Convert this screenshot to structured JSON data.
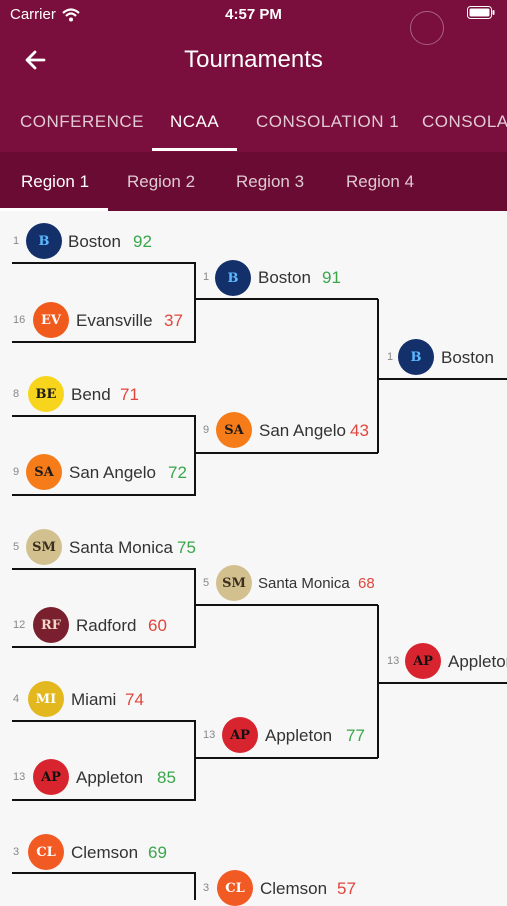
{
  "status": {
    "carrier": "Carrier",
    "time": "4:57 PM"
  },
  "header": {
    "title": "Tournaments"
  },
  "tabs": [
    "CONFERENCE",
    "NCAA",
    "CONSOLATION 1",
    "CONSOLAT"
  ],
  "regions": [
    "Region 1",
    "Region 2",
    "Region 3",
    "Region 4"
  ],
  "round1": [
    {
      "seed": "1",
      "logo": "B",
      "name": "Boston",
      "score": "92",
      "result": "win",
      "bg": "#14306b",
      "fg": "#5bb8ff"
    },
    {
      "seed": "16",
      "logo": "EV",
      "name": "Evansville",
      "score": "37",
      "result": "lose",
      "bg": "#f05a1c",
      "fg": "#ffffff"
    },
    {
      "seed": "8",
      "logo": "BE",
      "name": "Bend",
      "score": "71",
      "result": "lose",
      "bg": "#f7d51d",
      "fg": "#1a1a1a"
    },
    {
      "seed": "9",
      "logo": "SA",
      "name": "San Angelo",
      "score": "72",
      "result": "win",
      "bg": "#f57c18",
      "fg": "#1a1a1a"
    },
    {
      "seed": "5",
      "logo": "SM",
      "name": "Santa Monica",
      "score": "75",
      "result": "win",
      "bg": "#d2c08f",
      "fg": "#3a2f1c"
    },
    {
      "seed": "12",
      "logo": "RF",
      "name": "Radford",
      "score": "60",
      "result": "lose",
      "bg": "#7a1f2e",
      "fg": "#f2d7c8"
    },
    {
      "seed": "4",
      "logo": "MI",
      "name": "Miami",
      "score": "74",
      "result": "lose",
      "bg": "#e3b81f",
      "fg": "#ffffff"
    },
    {
      "seed": "13",
      "logo": "AP",
      "name": "Appleton",
      "score": "85",
      "result": "win",
      "bg": "#d8242e",
      "fg": "#111111"
    },
    {
      "seed": "3",
      "logo": "CL",
      "name": "Clemson",
      "score": "69",
      "result": "win",
      "bg": "#f25a24",
      "fg": "#ffffff"
    }
  ],
  "round2": [
    {
      "seed": "1",
      "logo": "B",
      "name": "Boston",
      "score": "91",
      "result": "win",
      "bg": "#14306b",
      "fg": "#5bb8ff"
    },
    {
      "seed": "9",
      "logo": "SA",
      "name": "San Angelo",
      "score": "43",
      "result": "lose",
      "bg": "#f57c18",
      "fg": "#1a1a1a"
    },
    {
      "seed": "5",
      "logo": "SM",
      "name": "Santa Monica",
      "score": "68",
      "result": "lose",
      "bg": "#d2c08f",
      "fg": "#3a2f1c"
    },
    {
      "seed": "13",
      "logo": "AP",
      "name": "Appleton",
      "score": "77",
      "result": "win",
      "bg": "#d8242e",
      "fg": "#111111"
    },
    {
      "seed": "3",
      "logo": "CL",
      "name": "Clemson",
      "score": "57",
      "result": "lose",
      "bg": "#f25a24",
      "fg": "#ffffff"
    }
  ],
  "round3": [
    {
      "seed": "1",
      "logo": "B",
      "name": "Boston",
      "bg": "#14306b",
      "fg": "#5bb8ff"
    },
    {
      "seed": "13",
      "logo": "AP",
      "name": "Appleton",
      "bg": "#d8242e",
      "fg": "#111111"
    }
  ]
}
